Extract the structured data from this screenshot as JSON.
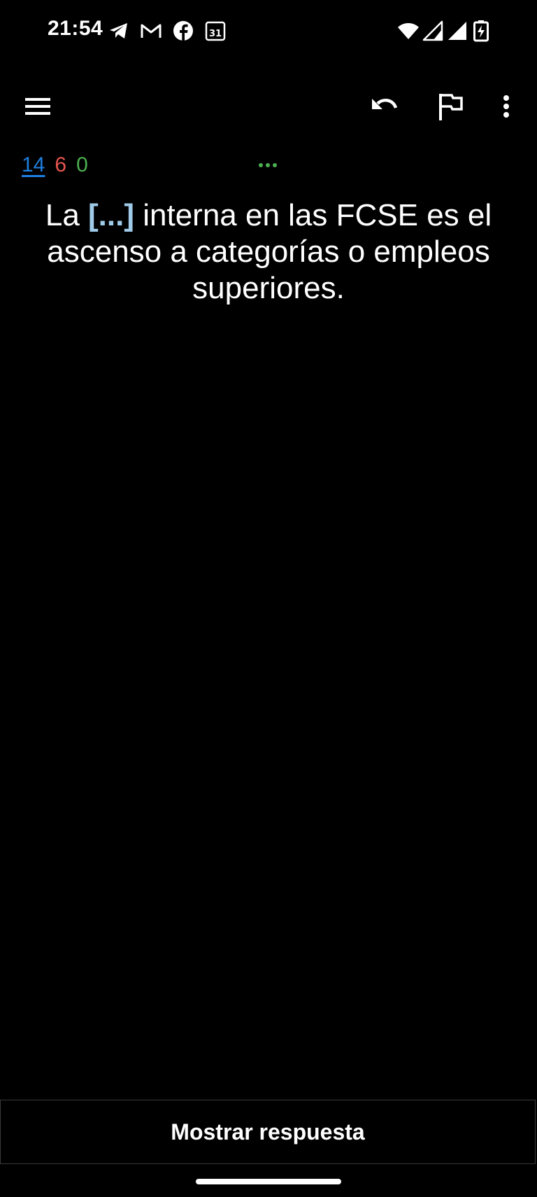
{
  "status_bar": {
    "time": "21:54",
    "left_icons": [
      "telegram-icon",
      "gmail-icon",
      "facebook-icon",
      "calendar-icon"
    ],
    "calendar_day": "31",
    "right_icons": [
      "wifi-icon",
      "signal-icon",
      "signal-icon",
      "battery-charging-icon"
    ]
  },
  "toolbar": {
    "icons": [
      "menu-icon",
      "undo-icon",
      "flag-icon",
      "more-vert-icon"
    ]
  },
  "counts": {
    "new": "14",
    "learning": "6",
    "review": "0"
  },
  "card": {
    "before": "La ",
    "cloze": "[...]",
    "after": " interna en las FCSE es el ascenso a categorías o empleos superiores."
  },
  "answer_button": {
    "label": "Mostrar respuesta"
  },
  "colors": {
    "new": "#1f7fe0",
    "learning": "#e8554e",
    "review": "#4caf50",
    "cloze": "#9fcbe9",
    "background": "#000000"
  }
}
